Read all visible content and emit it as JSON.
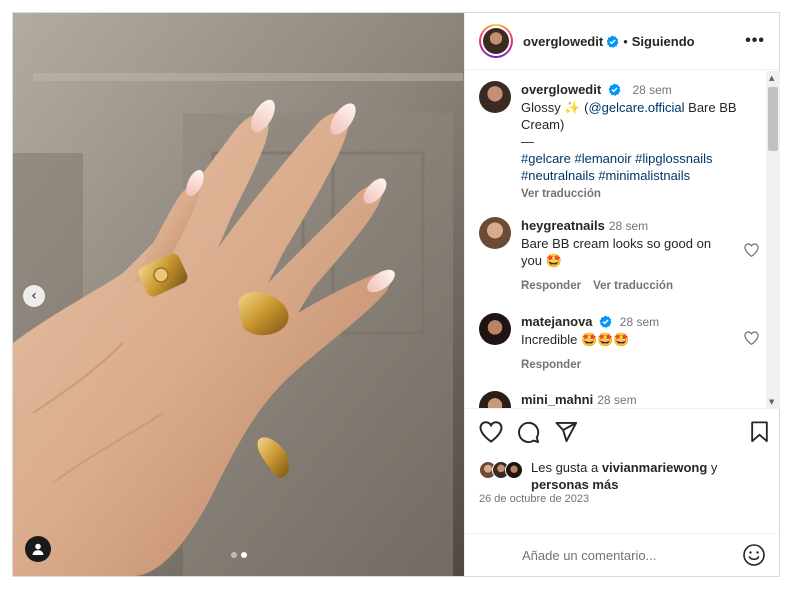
{
  "post": {
    "author": "overglowedit",
    "follow_status": "Siguiendo",
    "separator": "•",
    "more_label": "•••"
  },
  "caption": {
    "username": "overglowedit",
    "time": "28 sem",
    "line1_text": "Glossy ✨ (",
    "mention": "@gelcare.official",
    "line1_rest": " Bare BB Cream)",
    "dash": "—",
    "hashtags": "#gelcare #lemanoir #lipglossnails #neutralnails #minimalistnails",
    "translate": "Ver traducción"
  },
  "comments": [
    {
      "username": "heygreatnails",
      "time": "28 sem",
      "text": "Bare BB cream looks so good on you 🤩",
      "reply": "Responder",
      "translate": "Ver traducción"
    },
    {
      "username": "matejanova",
      "time": "28 sem",
      "text": "Incredible 🤩🤩🤩",
      "reply": "Responder"
    },
    {
      "username": "mini_mahni",
      "time": "28 sem"
    }
  ],
  "likes": {
    "prefix": "Les gusta a ",
    "user": "vivianmariewong",
    "suffix": " y ",
    "others": "personas más"
  },
  "date": "26 de octubre de 2023",
  "add_comment": {
    "placeholder": "Añade un comentario..."
  },
  "carousel": {
    "slide": 2,
    "total": 2
  },
  "icons": {
    "prev": "chevron-left-icon",
    "like": "heart-icon",
    "comment": "comment-icon",
    "share": "paper-plane-icon",
    "save": "bookmark-icon",
    "emoji": "smiley-icon",
    "verified": "verified-badge-icon"
  },
  "colors": {
    "verified": "#0095f6",
    "link": "#00376b",
    "muted": "#737373"
  }
}
